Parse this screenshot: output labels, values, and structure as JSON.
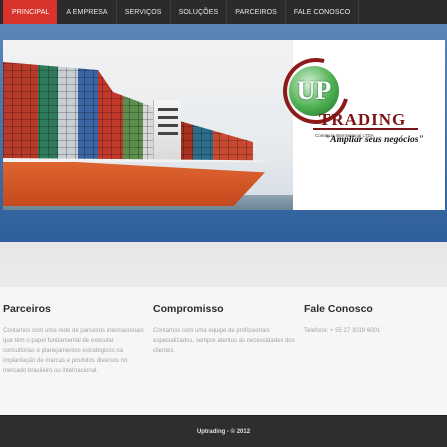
{
  "nav": {
    "items": [
      {
        "label": "PRINCIPAL",
        "active": true
      },
      {
        "label": "A EMPRESA",
        "active": false
      },
      {
        "label": "SERVIÇOS",
        "active": false
      },
      {
        "label": "SOLUÇÕES",
        "active": false
      },
      {
        "label": "PARCEIROS",
        "active": false
      },
      {
        "label": "FALE CONOSCO",
        "active": false
      }
    ]
  },
  "hero": {
    "brand_name": "TRADING",
    "brand_subtitle": "Comércio Internacional LTDA",
    "slogan": "\"Ampliar seus negócios\""
  },
  "columns": [
    {
      "title": "Parceiros",
      "text": "Contamos com uma rede de parceiros internacionais que têm o papel fundamental de executar consultorias e planejamentos estratégicos na implantação de marcas e produtos diversos no mercado brasileiro ou internacional."
    },
    {
      "title": "Compromisso",
      "text": "Contamos com uma equipe de profissionais especializados, sempre atentos às necessidades dos clientes."
    },
    {
      "title": "Fale Conosco",
      "text": "Telefone: + 55 27 3019 6001"
    }
  ],
  "footer": {
    "text": "Uptrading - © 2012"
  },
  "colors": {
    "nav_active": "#d9342b",
    "nav_bg": "#2b2b2b",
    "hero_band": "#3f6ea8",
    "footer_bg": "#2e2e2e"
  }
}
